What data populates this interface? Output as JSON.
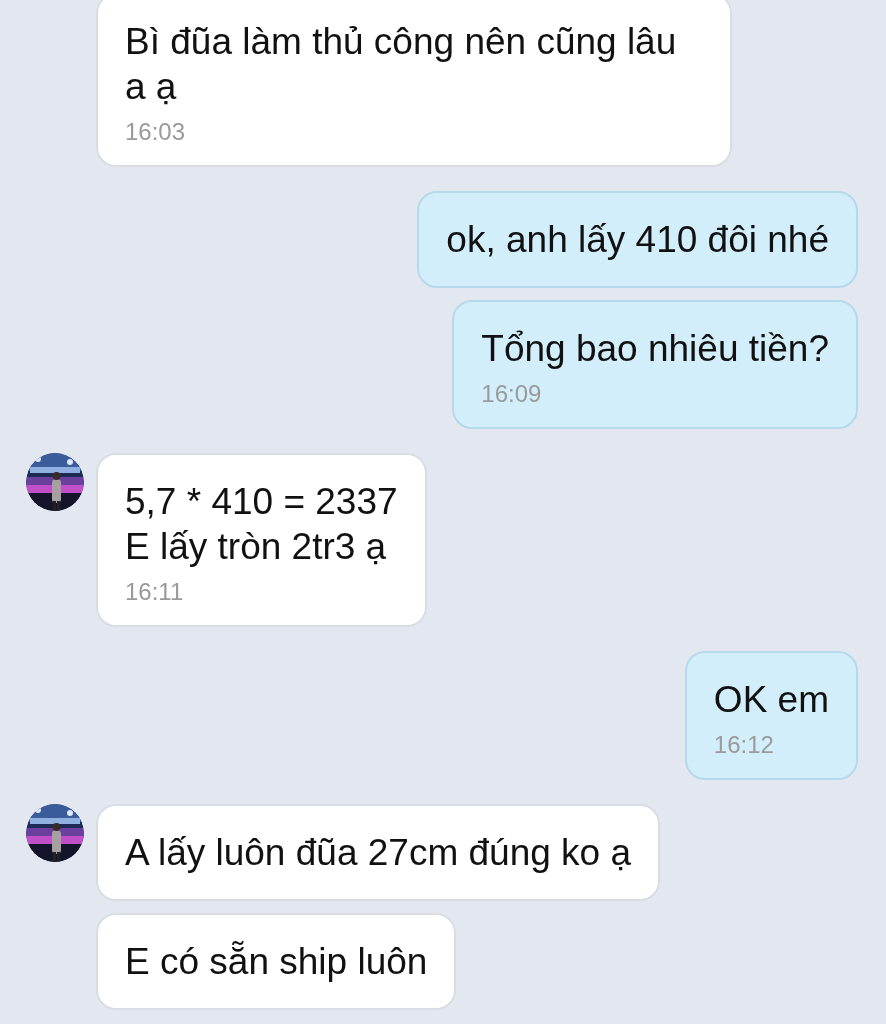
{
  "messages": [
    {
      "kind": "incoming",
      "avatar": false,
      "text": "Bì đũa làm thủ công nên cũng lâu a ạ",
      "time": "16:03"
    },
    {
      "kind": "outgoing",
      "avatar": false,
      "text": "ok, anh lấy 410 đôi nhé"
    },
    {
      "kind": "outgoing",
      "avatar": false,
      "text": "Tổng bao nhiêu tiền?",
      "time": "16:09"
    },
    {
      "kind": "incoming",
      "avatar": true,
      "text": "5,7 * 410 = 2337\nE lấy tròn 2tr3 ạ",
      "time": "16:11"
    },
    {
      "kind": "outgoing",
      "avatar": false,
      "text": "OK em",
      "time": "16:12"
    },
    {
      "kind": "incoming",
      "avatar": true,
      "text": "A lấy luôn đũa 27cm đúng ko ạ"
    },
    {
      "kind": "incoming",
      "avatar": false,
      "text": "E có sẵn ship luôn"
    }
  ]
}
